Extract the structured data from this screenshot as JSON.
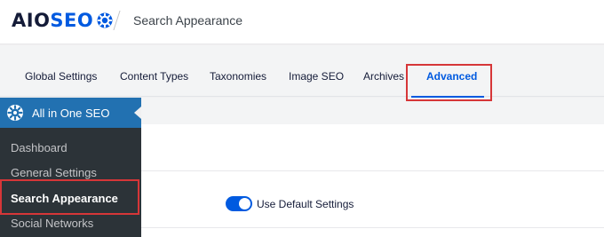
{
  "header": {
    "logo_prefix": "AIO",
    "logo_suffix": "SEO",
    "page_title": "Search Appearance"
  },
  "tabs": [
    {
      "label": "Global Settings"
    },
    {
      "label": "Content Types"
    },
    {
      "label": "Taxonomies"
    },
    {
      "label": "Image SEO"
    },
    {
      "label": "Archives"
    },
    {
      "label": "Advanced"
    }
  ],
  "active_tab": "Advanced",
  "sidebar": {
    "menu_title": "All in One SEO",
    "items": [
      {
        "label": "Dashboard"
      },
      {
        "label": "General Settings"
      },
      {
        "label": "Search Appearance"
      },
      {
        "label": "Social Networks"
      }
    ],
    "current_item": "Search Appearance"
  },
  "main": {
    "toggle_label": "Use Default Settings",
    "toggle_on": true
  },
  "colors": {
    "accent": "#005ae0",
    "wp_blue": "#2271b1",
    "sidebar_bg": "#1d2327",
    "highlight": "#d63638"
  },
  "icons": {
    "logo": "gear-icon",
    "menu": "aioseo-icon"
  }
}
